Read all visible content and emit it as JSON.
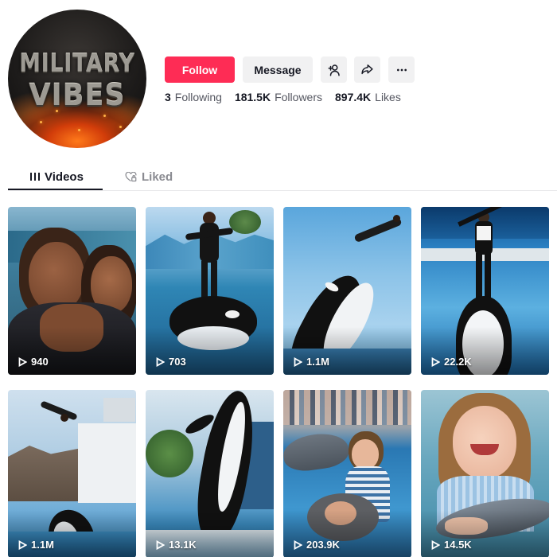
{
  "profile": {
    "avatar_text_line1": "MILITARY",
    "avatar_text_line2": "VIBES"
  },
  "actions": {
    "follow_label": "Follow",
    "message_label": "Message",
    "add_friend_icon": "add-user-icon",
    "share_icon": "share-icon",
    "more_icon": "more-icon"
  },
  "stats": {
    "following_count": "3",
    "following_label": "Following",
    "followers_count": "181.5K",
    "followers_label": "Followers",
    "likes_count": "897.4K",
    "likes_label": "Likes"
  },
  "tabs": {
    "videos_label": "Videos",
    "liked_label": "Liked",
    "active": "Videos"
  },
  "videos": [
    {
      "views": "940",
      "scene": "mother and daughter hugging by the water"
    },
    {
      "views": "703",
      "scene": "trainer standing on orca"
    },
    {
      "views": "1.1M",
      "scene": "orca breaching, trainer diving"
    },
    {
      "views": "22.2K",
      "scene": "trainer balancing on orca"
    },
    {
      "views": "1.1M",
      "scene": "trainer flying above orca show pool"
    },
    {
      "views": "13.1K",
      "scene": "orca leaping vertically"
    },
    {
      "views": "203.9K",
      "scene": "girl with dolphin at aquarium show"
    },
    {
      "views": "14.5K",
      "scene": "smiling girl hugging dolphin"
    }
  ],
  "colors": {
    "follow": "#fe2c55",
    "secondary_button": "#f1f1f2",
    "text_primary": "#161823",
    "text_secondary": "#545660",
    "tab_inactive": "#8a8b91"
  }
}
